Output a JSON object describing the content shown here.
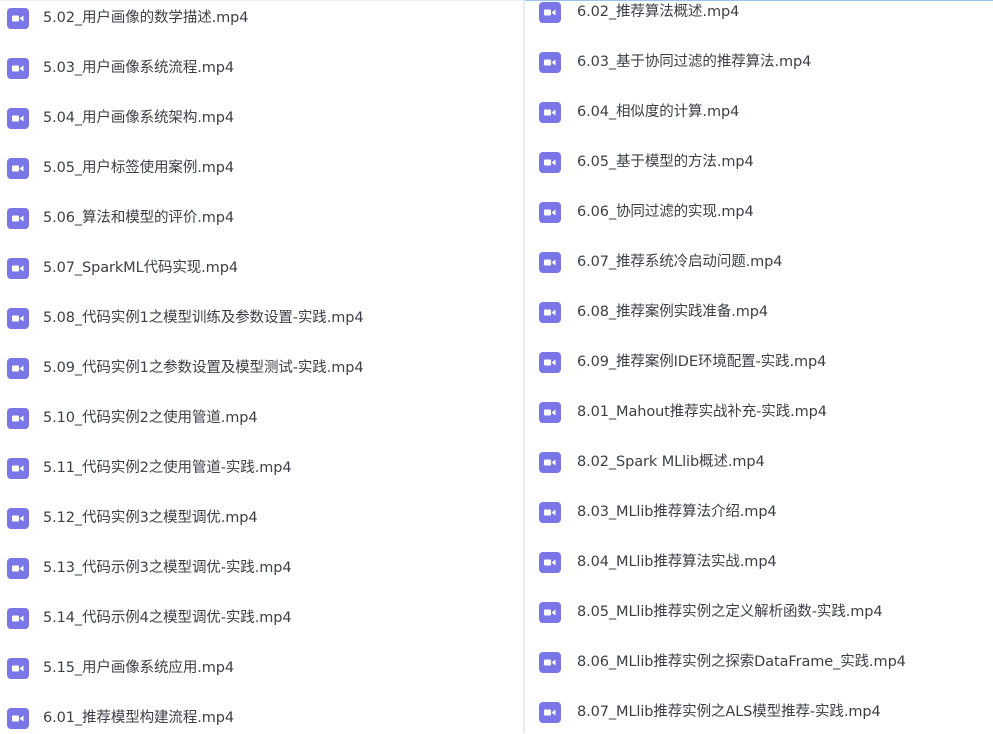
{
  "left_panel": {
    "files": [
      {
        "name": "5.02_用户画像的数学描述.mp4",
        "icon": "video-file-icon"
      },
      {
        "name": "5.03_用户画像系统流程.mp4",
        "icon": "video-file-icon"
      },
      {
        "name": "5.04_用户画像系统架构.mp4",
        "icon": "video-file-icon"
      },
      {
        "name": "5.05_用户标签使用案例.mp4",
        "icon": "video-file-icon"
      },
      {
        "name": "5.06_算法和模型的评价.mp4",
        "icon": "video-file-icon"
      },
      {
        "name": "5.07_SparkML代码实现.mp4",
        "icon": "video-file-icon"
      },
      {
        "name": "5.08_代码实例1之模型训练及参数设置-实践.mp4",
        "icon": "video-file-icon"
      },
      {
        "name": "5.09_代码实例1之参数设置及模型测试-实践.mp4",
        "icon": "video-file-icon"
      },
      {
        "name": "5.10_代码实例2之使用管道.mp4",
        "icon": "video-file-icon"
      },
      {
        "name": "5.11_代码实例2之使用管道-实践.mp4",
        "icon": "video-file-icon"
      },
      {
        "name": "5.12_代码实例3之模型调优.mp4",
        "icon": "video-file-icon"
      },
      {
        "name": "5.13_代码示例3之模型调优-实践.mp4",
        "icon": "video-file-icon"
      },
      {
        "name": "5.14_代码示例4之模型调优-实践.mp4",
        "icon": "video-file-icon"
      },
      {
        "name": "5.15_用户画像系统应用.mp4",
        "icon": "video-file-icon"
      },
      {
        "name": "6.01_推荐模型构建流程.mp4",
        "icon": "video-file-icon"
      }
    ]
  },
  "right_panel": {
    "files": [
      {
        "name": "6.02_推荐算法概述.mp4",
        "icon": "video-file-icon"
      },
      {
        "name": "6.03_基于协同过滤的推荐算法.mp4",
        "icon": "video-file-icon"
      },
      {
        "name": "6.04_相似度的计算.mp4",
        "icon": "video-file-icon"
      },
      {
        "name": "6.05_基于模型的方法.mp4",
        "icon": "video-file-icon"
      },
      {
        "name": "6.06_协同过滤的实现.mp4",
        "icon": "video-file-icon"
      },
      {
        "name": "6.07_推荐系统冷启动问题.mp4",
        "icon": "video-file-icon"
      },
      {
        "name": "6.08_推荐案例实践准备.mp4",
        "icon": "video-file-icon"
      },
      {
        "name": "6.09_推荐案例IDE环境配置-实践.mp4",
        "icon": "video-file-icon"
      },
      {
        "name": "8.01_Mahout推荐实战补充-实践.mp4",
        "icon": "video-file-icon"
      },
      {
        "name": "8.02_Spark MLlib概述.mp4",
        "icon": "video-file-icon"
      },
      {
        "name": "8.03_MLlib推荐算法介绍.mp4",
        "icon": "video-file-icon"
      },
      {
        "name": "8.04_MLlib推荐算法实战.mp4",
        "icon": "video-file-icon"
      },
      {
        "name": "8.05_MLlib推荐实例之定义解析函数-实践.mp4",
        "icon": "video-file-icon"
      },
      {
        "name": "8.06_MLlib推荐实例之探索DataFrame_实践.mp4",
        "icon": "video-file-icon"
      },
      {
        "name": "8.07_MLlib推荐实例之ALS模型推荐-实践.mp4",
        "icon": "video-file-icon"
      }
    ]
  },
  "colors": {
    "icon_bg": "#7b76e8",
    "text": "#3b3f45",
    "accent_line": "#9ec3ea"
  }
}
